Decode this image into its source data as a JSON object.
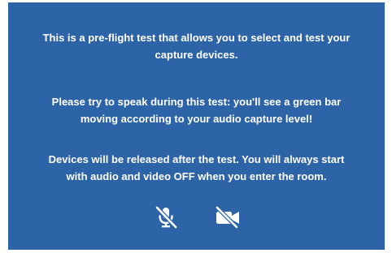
{
  "dialog": {
    "paragraphs": [
      {
        "lines": [
          "This is a pre-flight test that allows you to select and test your",
          "capture devices."
        ]
      },
      {
        "lines": [
          "Please try to speak during this test: you'll see a green bar",
          "moving according to your audio capture level!"
        ]
      },
      {
        "lines": [
          "Devices will be released after the test. You will always start",
          "with audio and video OFF when you enter the room."
        ]
      }
    ]
  },
  "controls": {
    "microphone": {
      "icon": "microphone-off-icon",
      "state": "off"
    },
    "camera": {
      "icon": "video-camera-off-icon",
      "state": "off"
    }
  },
  "colors": {
    "panel_background": "#2d64a8",
    "text": "#ffffff"
  }
}
